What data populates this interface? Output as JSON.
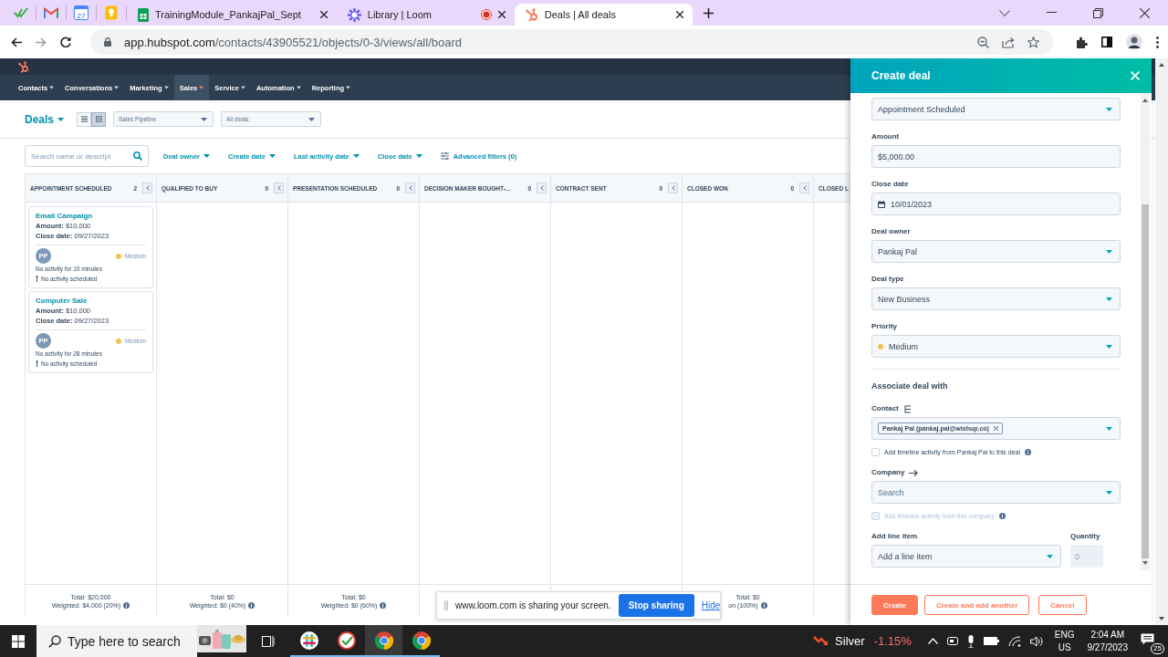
{
  "browser": {
    "pinned_tabs": [
      {
        "kind": "check"
      },
      {
        "kind": "mail"
      },
      {
        "kind": "calendar",
        "label": "27"
      },
      {
        "kind": "bulb"
      }
    ],
    "tabs": [
      {
        "title": "TrainingModule_PankajPal_Sept",
        "kind": "sheet",
        "selected": false,
        "recording": false
      },
      {
        "title": "Library | Loom",
        "kind": "loom",
        "selected": false,
        "recording": true
      },
      {
        "title": "Deals | All deals",
        "kind": "hubspot",
        "selected": true,
        "recording": false
      }
    ],
    "address": {
      "host": "app.hubspot.com",
      "path": "/contacts/43905521/objects/0-3/views/all/board"
    }
  },
  "nav": [
    {
      "label": "Contacts",
      "selected": false
    },
    {
      "label": "Conversations",
      "selected": false
    },
    {
      "label": "Marketing",
      "selected": false
    },
    {
      "label": "Sales",
      "selected": true
    },
    {
      "label": "Service",
      "selected": false
    },
    {
      "label": "Automation",
      "selected": false
    },
    {
      "label": "Reporting",
      "selected": false
    }
  ],
  "deals_header": {
    "title": "Deals",
    "views": [
      {
        "kind": "list",
        "selected": false
      },
      {
        "kind": "board",
        "selected": true
      }
    ],
    "pipeline": "Sales Pipeline",
    "view_filter": "All deals"
  },
  "filters": {
    "search_placeholder": "Search name or descript",
    "items": [
      "Deal owner",
      "Create date",
      "Last activity date",
      "Close date"
    ],
    "advanced": "Advanced filters (0)"
  },
  "columns": [
    {
      "name": "APPOINTMENT SCHEDULED",
      "count": "2",
      "total": "Total: $20,000",
      "weighted": "Weighted: $4,000 (20%)",
      "cards": [
        {
          "title": "Email Campaign",
          "amount": "**Amount:** $10,000",
          "close_date": "**Close date:** 09/27/2023",
          "owner": "PP",
          "priority": "Medium",
          "color": "#f2c056",
          "activity": "No activity for 10 minutes",
          "next_activity": "No activity scheduled"
        },
        {
          "title": "Computer Sale",
          "amount": "**Amount:** $10,000",
          "close_date": "**Close date:** 09/27/2023",
          "owner": "PP",
          "priority": "Medium",
          "color": "#f2c056",
          "activity": "No activity for 28 minutes",
          "next_activity": "No activity scheduled"
        }
      ]
    },
    {
      "name": "QUALIFIED TO BUY",
      "count": "0",
      "total": "Total: $0",
      "weighted": "Weighted: $0 (40%)"
    },
    {
      "name": "PRESENTATION SCHEDULED",
      "count": "0",
      "total": "Total: $0",
      "weighted": "Weighted: $0 (60%)"
    },
    {
      "name": "DECISION MAKER BOUGHT-...",
      "count": "0"
    },
    {
      "name": "CONTRACT SENT",
      "count": "0"
    },
    {
      "name": "CLOSED WON",
      "count": "0",
      "total": "Total: $0",
      "weighted": "on (100%)"
    },
    {
      "name": "CLOSED L"
    }
  ],
  "share_bar": {
    "message": "www.loom.com is sharing your screen.",
    "stop": "Stop sharing",
    "hide": "Hide"
  },
  "panel": {
    "title": "Create deal",
    "fields": [
      {
        "kind": "select",
        "value": "Appointment Scheduled"
      },
      {
        "kind": "text",
        "label": "Amount",
        "value": "$5,000.00"
      },
      {
        "kind": "date",
        "label": "Close date",
        "value": "10/01/2023"
      },
      {
        "kind": "select",
        "label": "Deal owner",
        "value": "Pankaj Pal"
      },
      {
        "kind": "select",
        "label": "Deal type",
        "value": "New Business"
      },
      {
        "kind": "select",
        "label": "Priority",
        "value": "Medium",
        "color": "#f2c056"
      },
      {
        "kind": "heading",
        "label": "Associate deal with"
      },
      {
        "kind": "chips",
        "label": "Contact",
        "chips": [
          "Pankaj Pal (pankaj.pal@wishup.co)"
        ]
      },
      {
        "kind": "checkbox",
        "label": "Add timeline activity from Pankaj Pal to this deal",
        "checked": false,
        "disabled": false
      },
      {
        "kind": "link-select",
        "label": "Company",
        "placeholder": "Search"
      },
      {
        "kind": "checkbox",
        "label": "Add timeline activity from this company",
        "checked": false,
        "disabled": true
      },
      {
        "kind": "line-item",
        "label": "Add line item",
        "placeholder": "Add a line item",
        "quantity_label": "Quantity",
        "quantity_placeholder": "0",
        "quantity_disabled": true
      }
    ],
    "buttons": [
      {
        "label": "Create",
        "kind": "primary"
      },
      {
        "label": "Create and add another",
        "kind": "secondary"
      },
      {
        "label": "Cancel",
        "kind": "secondary"
      }
    ]
  },
  "taskbar": {
    "search_placeholder": "Type here to search",
    "apps": [
      {
        "kind": "hash",
        "selected": false
      },
      {
        "kind": "tick",
        "selected": false
      },
      {
        "kind": "browser",
        "selected": true
      },
      {
        "kind": "browser",
        "selected": false
      }
    ],
    "stock": {
      "name": "Silver",
      "change": "-1.15%"
    },
    "language": "ENG",
    "region": "US",
    "time": "2:04 AM",
    "date": "9/27/2023",
    "notifications": "25"
  }
}
